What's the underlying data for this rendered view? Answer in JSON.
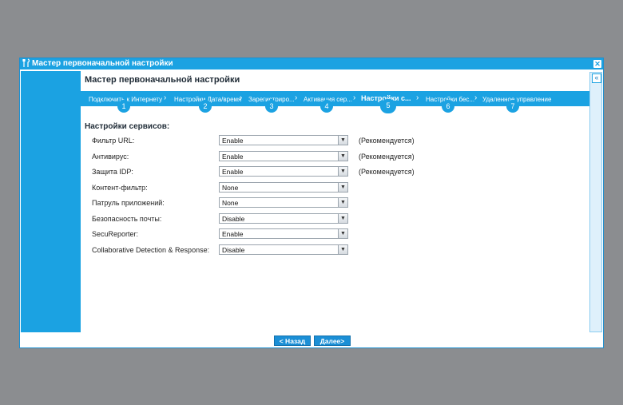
{
  "window": {
    "title": "Мастер первоначальной настройки",
    "close_glyph": "✕"
  },
  "wizard": {
    "title": "Мастер первоначальной настройки",
    "collapse_glyph": "«"
  },
  "steps": [
    {
      "label": "Подключить к Интернету",
      "num": "1"
    },
    {
      "label": "Настройки Дата/время",
      "num": "2"
    },
    {
      "label": "Зарегистриро...",
      "num": "3"
    },
    {
      "label": "Активация сер...",
      "num": "4"
    },
    {
      "label": "Настройки с...",
      "num": "5"
    },
    {
      "label": "Настройки бес...",
      "num": "6"
    },
    {
      "label": "Удаленное управление",
      "num": "7"
    }
  ],
  "active_step": 5,
  "section": {
    "title": "Настройки сервисов:"
  },
  "services": [
    {
      "label": "Фильтр URL:",
      "value": "Enable",
      "note": "(Рекомендуется)"
    },
    {
      "label": "Антивирус:",
      "value": "Enable",
      "note": "(Рекомендуется)"
    },
    {
      "label": "Защита IDP:",
      "value": "Enable",
      "note": "(Рекомендуется)"
    },
    {
      "label": "Контент-фильтр:",
      "value": "None",
      "note": ""
    },
    {
      "label": "Патруль приложений:",
      "value": "None",
      "note": ""
    },
    {
      "label": "Безопасность почты:",
      "value": "Disable",
      "note": ""
    },
    {
      "label": "SecuReporter:",
      "value": "Enable",
      "note": ""
    },
    {
      "label": "Collaborative Detection & Response:",
      "value": "Disable",
      "note": ""
    }
  ],
  "buttons": {
    "back": "< Назад",
    "next": "Далее>"
  },
  "colors": {
    "accent": "#1ba2e2",
    "background": "#8b8d90"
  }
}
